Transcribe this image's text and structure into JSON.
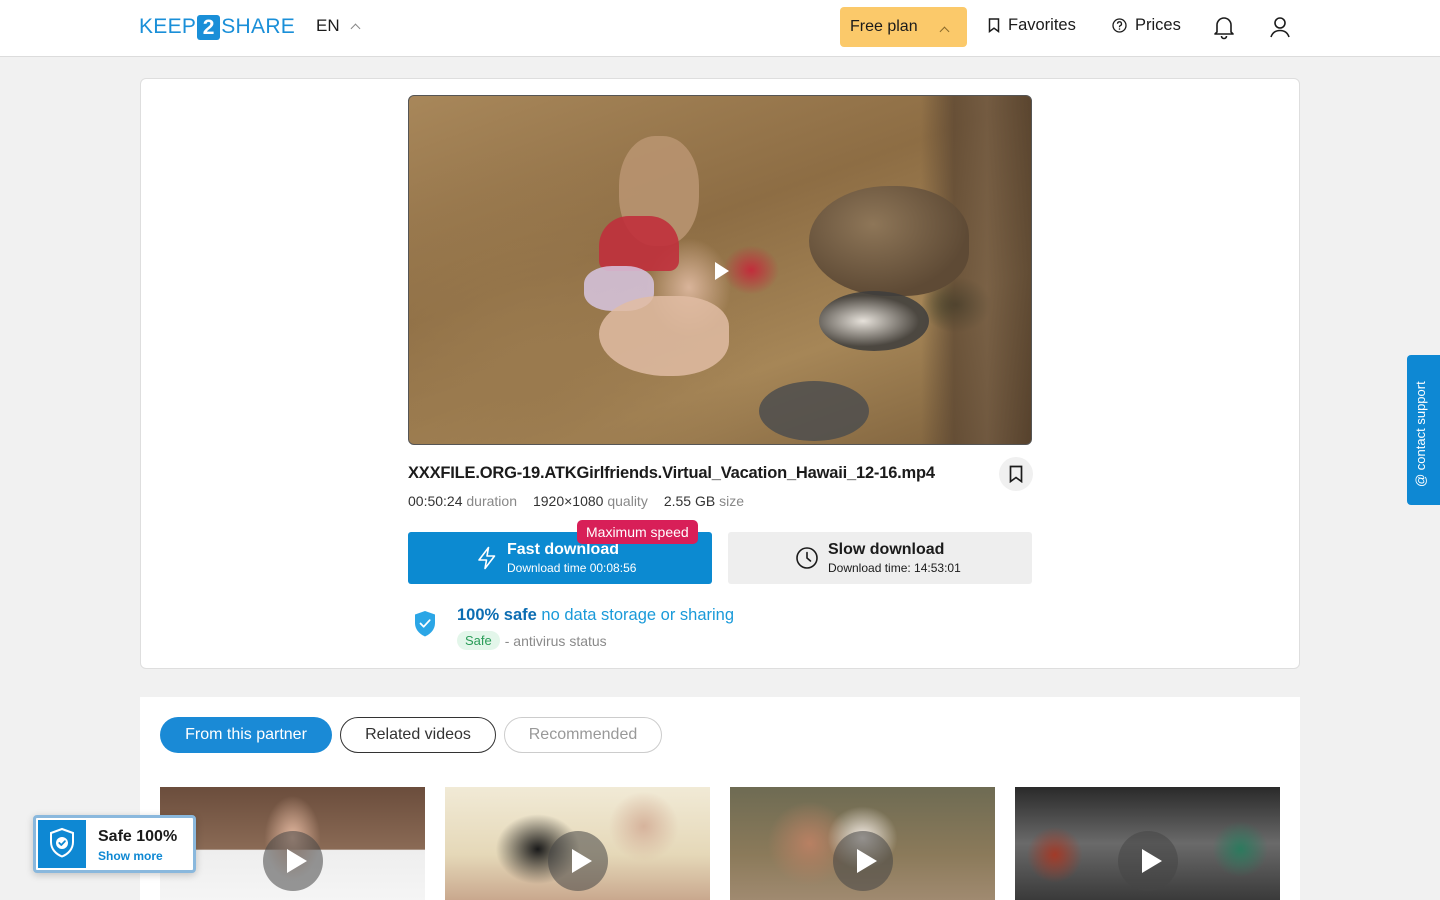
{
  "header": {
    "logo_left": "KEEP",
    "logo_mid": "2",
    "logo_right": "SHARE",
    "language": "EN",
    "plan_label": "Free plan",
    "favorites_label": "Favorites",
    "prices_label": "Prices"
  },
  "file": {
    "name": "XXXFILE.ORG-19.ATKGirlfriends.Virtual_Vacation_Hawaii_12-16.mp4",
    "duration_value": "00:50:24",
    "duration_label": "duration",
    "quality_value": "1920×1080",
    "quality_label": "quality",
    "size_value": "2.55 GB",
    "size_label": "size"
  },
  "download": {
    "fast_title": "Fast download",
    "fast_time": "Download time 00:08:56",
    "badge": "Maximum speed",
    "slow_title": "Slow download",
    "slow_time": "Download time: 14:53:01"
  },
  "safety": {
    "safe_bold": "100% safe",
    "safe_text": "no data storage or sharing",
    "status_pill": "Safe",
    "status_text": "- antivirus status"
  },
  "tabs": {
    "partner": "From this partner",
    "related": "Related videos",
    "recommended": "Recommended"
  },
  "widget": {
    "title": "Safe 100%",
    "link": "Show more"
  },
  "support": {
    "label": "@ contact support"
  },
  "colors": {
    "accent": "#0c8ad1",
    "plan": "#fbc96a",
    "badge": "#d81f58"
  }
}
